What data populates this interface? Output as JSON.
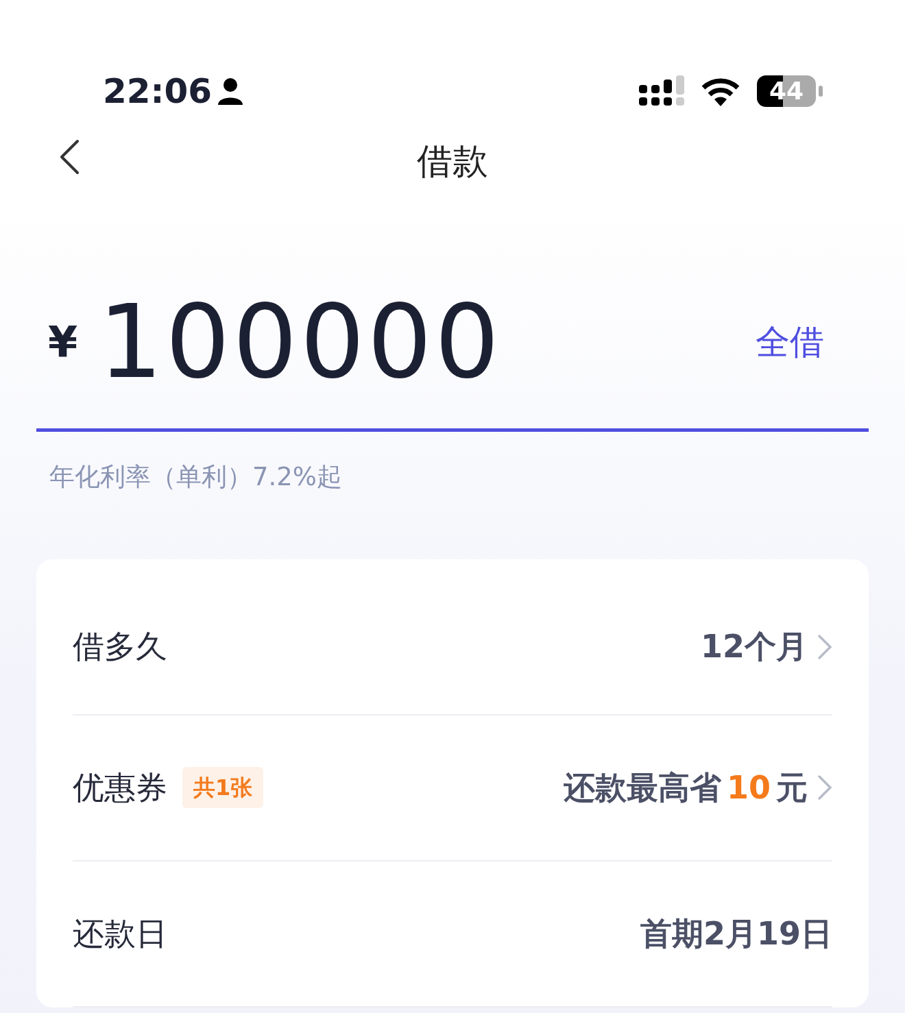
{
  "status_bar": {
    "time": "22:06",
    "battery": "44"
  },
  "nav": {
    "title": "借款"
  },
  "amount": {
    "currency": "¥",
    "value": "100000",
    "action": "全借"
  },
  "rate_note": "年化利率（单利）7.2%起",
  "rows": [
    {
      "label": "借多久",
      "segments": [
        {
          "text": "12个月",
          "highlight": false
        }
      ],
      "chevron": true
    },
    {
      "label": "优惠券",
      "badge": "共1张",
      "segments": [
        {
          "text": "还款最高省",
          "highlight": false
        },
        {
          "text": "10",
          "highlight": true
        },
        {
          "text": "元",
          "highlight": false
        }
      ],
      "chevron": true
    },
    {
      "label": "还款日",
      "segments": [
        {
          "text": "首期2月19日",
          "highlight": false
        }
      ],
      "chevron": false
    }
  ]
}
